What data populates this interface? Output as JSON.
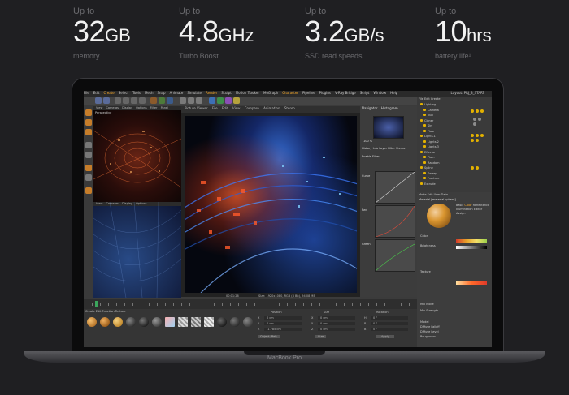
{
  "specs": [
    {
      "prefix": "Up to",
      "value": "32",
      "unit": "GB",
      "label": "memory"
    },
    {
      "prefix": "Up to",
      "value": "4.8",
      "unit": "GHz",
      "label": "Turbo Boost"
    },
    {
      "prefix": "Up to",
      "value": "3.2",
      "unit": "GB/s",
      "label": "SSD read speeds"
    },
    {
      "prefix": "Up to",
      "value": "10",
      "unit": "hrs",
      "label": "battery life¹"
    }
  ],
  "device": {
    "brand": "MacBook Pro"
  },
  "app": {
    "menu": [
      "File",
      "Edit",
      "Create",
      "Select",
      "Tools",
      "Mesh",
      "Snap",
      "Animate",
      "Simulate",
      "Render",
      "Sculpt",
      "Motion Tracker",
      "MoGraph",
      "Character",
      "Pipeline",
      "Plugins",
      "V-Ray Bridge",
      "Script",
      "Window",
      "Help"
    ],
    "layout_label": "Layout: PRJ_3_START",
    "viewport_tabs": [
      "View",
      "Cameras",
      "Display",
      "Options",
      "Filter",
      "Panel"
    ],
    "viewport_label": "Perspective",
    "render_tabs": [
      "File",
      "Edit",
      "View",
      "Compare",
      "Animation",
      "Stereo"
    ],
    "render_title": "Picture Viewer",
    "navigator_tabs": [
      "Navigator",
      "Histogram"
    ],
    "right_tabs": [
      "History",
      "Info",
      "Layer",
      "Filter",
      "Stereo"
    ],
    "filter_label": "Enable Filter",
    "curve_labels": [
      "Curve",
      "Red",
      "Green"
    ],
    "status_text": "Size: 1920x1080, RGB (8 Bit), 94.08 MB",
    "timecode": "00:01:26",
    "zoom": "100 %",
    "objects": [
      "Lighting",
      "Camera",
      "Null",
      "Cloner",
      "Sky",
      "Floor",
      "Lights.1",
      "Lights.2",
      "Lights.3",
      "Effector",
      "Plain",
      "Random",
      "Spline",
      "Sweep",
      "Fracture",
      "Extrude"
    ],
    "attr_mode": [
      "Mode",
      "Edit",
      "User Data"
    ],
    "attr_title": "Material [material sphere]",
    "attr_tabs": [
      "Basic",
      "Color",
      "Reflectance",
      "Illumination",
      "Editor",
      "Assign"
    ],
    "attr_fields": [
      "Color",
      "Brightness",
      "Texture",
      "Mix Mode",
      "Mix Strength",
      "Model",
      "Diffuse Falloff",
      "Diffuse Level",
      "Roughness"
    ],
    "coord_headers": [
      "Position",
      "Size",
      "Rotation"
    ],
    "coord_rows": [
      {
        "a": "X",
        "av": "0 cm",
        "b": "X",
        "bv": "0 cm",
        "c": "H",
        "cv": "0 °"
      },
      {
        "a": "Y",
        "av": "0 cm",
        "b": "Y",
        "bv": "0 cm",
        "c": "P",
        "cv": "0 °"
      },
      {
        "a": "Z",
        "av": "-1.785 cm",
        "b": "Z",
        "bv": "0 cm",
        "c": "B",
        "cv": "0 °"
      }
    ],
    "coord_mode": [
      "Object (Rel)",
      "Size"
    ],
    "apply_label": "Apply",
    "material_tabs": [
      "Create",
      "Edit",
      "Function",
      "Texture"
    ]
  }
}
